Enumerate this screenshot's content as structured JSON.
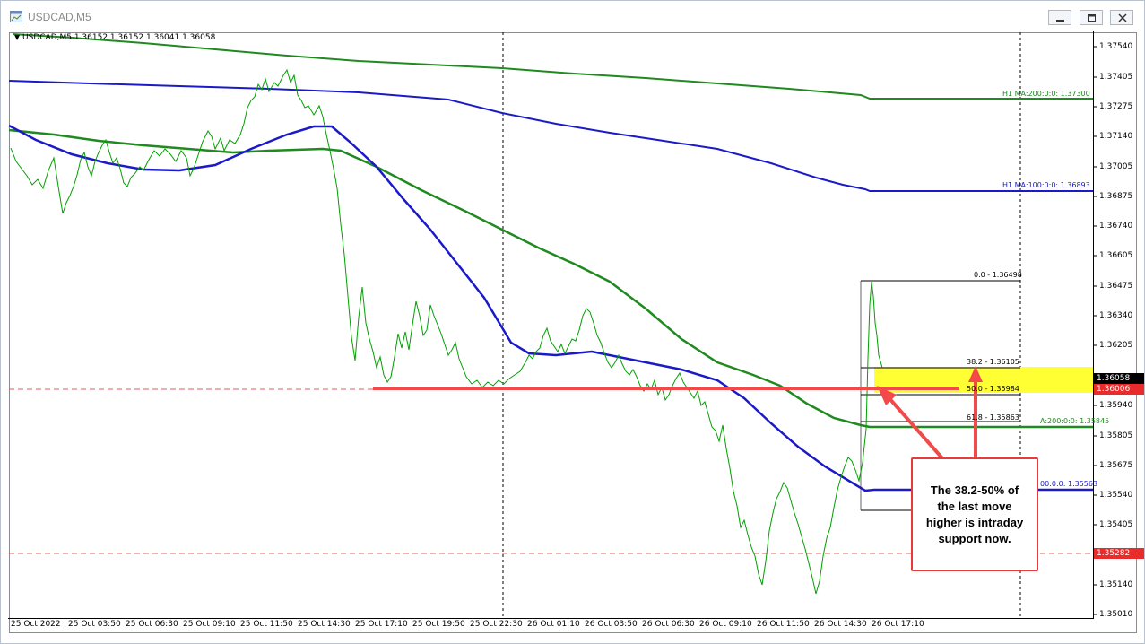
{
  "window": {
    "title": "USDCAD,M5"
  },
  "chart_info": "USDCAD,M5  1.36152 1.36152 1.36041 1.36058",
  "price_axis": [
    "1.37540",
    "1.37405",
    "1.37275",
    "1.37140",
    "1.37005",
    "1.36875",
    "1.36740",
    "1.36605",
    "1.36475",
    "1.36340",
    "1.36205",
    "1.35940",
    "1.35805",
    "1.35675",
    "1.35540",
    "1.35405",
    "1.35140",
    "1.35010"
  ],
  "time_axis": [
    "25 Oct 2022",
    "25 Oct 03:50",
    "25 Oct 06:30",
    "25 Oct 09:10",
    "25 Oct 11:50",
    "25 Oct 14:30",
    "25 Oct 17:10",
    "25 Oct 19:50",
    "25 Oct 22:30",
    "26 Oct 01:10",
    "26 Oct 03:50",
    "26 Oct 06:30",
    "26 Oct 09:10",
    "26 Oct 11:50",
    "26 Oct 14:30",
    "26 Oct 17:10"
  ],
  "price_tags": {
    "bid": "1.36058",
    "support": "1.36006",
    "low": "1.35282"
  },
  "fibo": {
    "l0": "0.0 - 1.36498",
    "l382": "38.2 - 1.36105",
    "l50": "50.0 - 1.35984",
    "l618": "61.8 - 1.35863"
  },
  "ma_labels": {
    "h1_ma200": "H1 MA:200:0:0: 1.37300",
    "h1_ma100": "H1 MA:100:0:0: 1.36893",
    "ma200": "A:200:0:0: 1.35845",
    "ma100": "00:0:0: 1.35563"
  },
  "callout": {
    "line1": "The 38.2-50%  of",
    "line2": "the last move",
    "line3": "higher is intraday",
    "line4": "support now."
  },
  "colors": {
    "candle": "#00a000",
    "ma_green": "#1f8a1f",
    "ma_blue": "#1a1ac8",
    "annotation_red": "#f24a4a",
    "highlight": "#ffff33"
  }
}
